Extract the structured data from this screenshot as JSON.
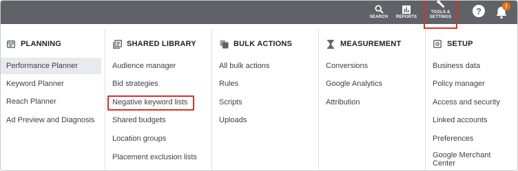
{
  "topbar": {
    "search_label": "SEARCH",
    "reports_label": "REPORTS",
    "tools_label_line1": "TOOLS &",
    "tools_label_line2": "SETTINGS",
    "notification_badge": "!",
    "help_glyph": "?"
  },
  "columns": [
    {
      "heading": "PLANNING",
      "icon": "calendar-icon",
      "items": [
        "Performance Planner",
        "Keyword Planner",
        "Reach Planner",
        "Ad Preview and Diagnosis"
      ]
    },
    {
      "heading": "SHARED LIBRARY",
      "icon": "library-icon",
      "items": [
        "Audience manager",
        "Bid strategies",
        "Negative keyword lists",
        "Shared budgets",
        "Location groups",
        "Placement exclusion lists"
      ]
    },
    {
      "heading": "BULK ACTIONS",
      "icon": "copy-icon",
      "items": [
        "All bulk actions",
        "Rules",
        "Scripts",
        "Uploads"
      ]
    },
    {
      "heading": "MEASUREMENT",
      "icon": "hourglass-icon",
      "items": [
        "Conversions",
        "Google Analytics",
        "Attribution"
      ]
    },
    {
      "heading": "SETUP",
      "icon": "settings-box-icon",
      "items": [
        "Business data",
        "Policy manager",
        "Access and security",
        "Linked accounts",
        "Preferences",
        "Google Merchant Center"
      ]
    }
  ],
  "selected_item": "Performance Planner",
  "colors": {
    "topbar": "#5f6368",
    "highlight": "#d93025",
    "badge": "#e8710a",
    "selected_bg": "#e8eaed"
  }
}
